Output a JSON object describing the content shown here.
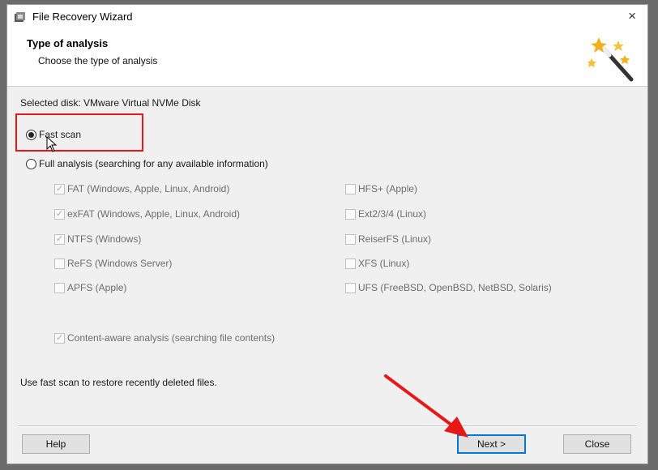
{
  "window": {
    "title": "File Recovery Wizard",
    "close_glyph": "×"
  },
  "header": {
    "title": "Type of analysis",
    "subtitle": "Choose the type of analysis",
    "icon": "magic-wand-icon"
  },
  "selected_disk": "Selected disk: VMware Virtual NVMe Disk",
  "scan_options": {
    "fast_scan": {
      "label": "Fast scan",
      "selected": true
    },
    "full_analysis": {
      "label": "Full analysis (searching for any available information)",
      "selected": false
    }
  },
  "filesystems": {
    "left": [
      {
        "label": "FAT (Windows, Apple, Linux, Android)",
        "checked": true
      },
      {
        "label": "exFAT (Windows, Apple, Linux, Android)",
        "checked": true
      },
      {
        "label": "NTFS (Windows)",
        "checked": true
      },
      {
        "label": "ReFS (Windows Server)",
        "checked": false
      },
      {
        "label": "APFS (Apple)",
        "checked": false
      }
    ],
    "right": [
      {
        "label": "HFS+ (Apple)",
        "checked": false
      },
      {
        "label": "Ext2/3/4 (Linux)",
        "checked": false
      },
      {
        "label": "ReiserFS (Linux)",
        "checked": false
      },
      {
        "label": "XFS (Linux)",
        "checked": false
      },
      {
        "label": "UFS (FreeBSD, OpenBSD, NetBSD, Solaris)",
        "checked": false
      }
    ]
  },
  "content_aware": {
    "label": "Content-aware analysis (searching file contents)",
    "checked": true
  },
  "hint": "Use fast scan to restore recently deleted files.",
  "buttons": {
    "help": "Help",
    "next": "Next >",
    "close": "Close"
  },
  "colors": {
    "annotation_red": "#e81818",
    "primary_button_border": "#0078d7"
  }
}
